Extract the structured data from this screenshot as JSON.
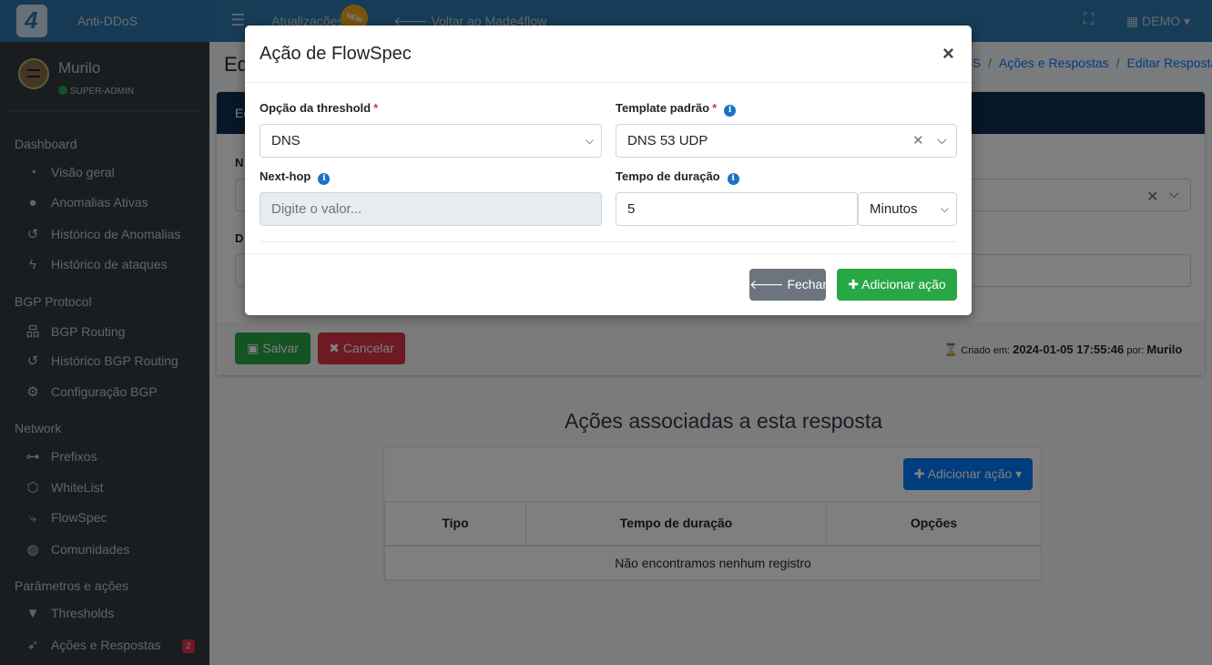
{
  "topbar": {
    "app_name": "Anti-DDoS",
    "updates_label": "Atualizações",
    "new_badge": "NEW",
    "back_label": "Voltar ao Made4flow",
    "company": "DEMO"
  },
  "user": {
    "name": "Murilo",
    "role": "SUPER-ADMIN"
  },
  "sidebar": {
    "sections": [
      {
        "header": "Dashboard",
        "items": [
          {
            "label": "Visão geral",
            "icon": "gauge-icon"
          },
          {
            "label": "Anomalias Ativas",
            "icon": "alert-circle-icon"
          },
          {
            "label": "Histórico de Anomalias",
            "icon": "history-icon"
          },
          {
            "label": "Histórico de ataques",
            "icon": "bolt-icon"
          }
        ]
      },
      {
        "header": "BGP Protocol",
        "items": [
          {
            "label": "BGP Routing",
            "icon": "network-icon"
          },
          {
            "label": "Histórico BGP Routing",
            "icon": "history-icon"
          },
          {
            "label": "Configuração BGP",
            "icon": "gear-icon"
          }
        ]
      },
      {
        "header": "Network",
        "items": [
          {
            "label": "Prefixos",
            "icon": "tree-icon"
          },
          {
            "label": "WhiteList",
            "icon": "hexagon-icon"
          },
          {
            "label": "FlowSpec",
            "icon": "route-icon"
          },
          {
            "label": "Comunidades",
            "icon": "globe-icon"
          }
        ]
      },
      {
        "header": "Parâmetros e ações",
        "items": [
          {
            "label": "Thresholds",
            "icon": "filter-icon"
          },
          {
            "label": "Ações e Respostas",
            "icon": "rocket-icon",
            "badge": "2"
          }
        ]
      }
    ]
  },
  "page": {
    "title": "Ed",
    "breadcrumb": [
      "oS",
      "Ações e Respostas",
      "Editar Resposta"
    ],
    "card_header": "Ed",
    "label_n": "N",
    "label_d": "D",
    "save_label": "Salvar",
    "cancel_label": "Cancelar",
    "created_prefix": "Criado em:",
    "created_at": "2024-01-05 17:55:46",
    "created_by_prefix": "por:",
    "created_by": "Murilo"
  },
  "actions_section": {
    "title": "Ações associadas a esta resposta",
    "add_button": "Adicionar ação",
    "columns": [
      "Tipo",
      "Tempo de duração",
      "Opções"
    ],
    "empty_message": "Não encontramos nenhum registro"
  },
  "modal": {
    "title": "Ação de FlowSpec",
    "threshold_label": "Opção da threshold",
    "threshold_value": "DNS",
    "template_label": "Template padrão",
    "template_value": "DNS 53 UDP",
    "nexthop_label": "Next-hop",
    "nexthop_placeholder": "Digite o valor...",
    "duration_label": "Tempo de duração",
    "duration_value": "5",
    "duration_unit": "Minutos",
    "close_button": "Fechar",
    "add_button": "Adicionar ação",
    "required_mark": "*"
  }
}
